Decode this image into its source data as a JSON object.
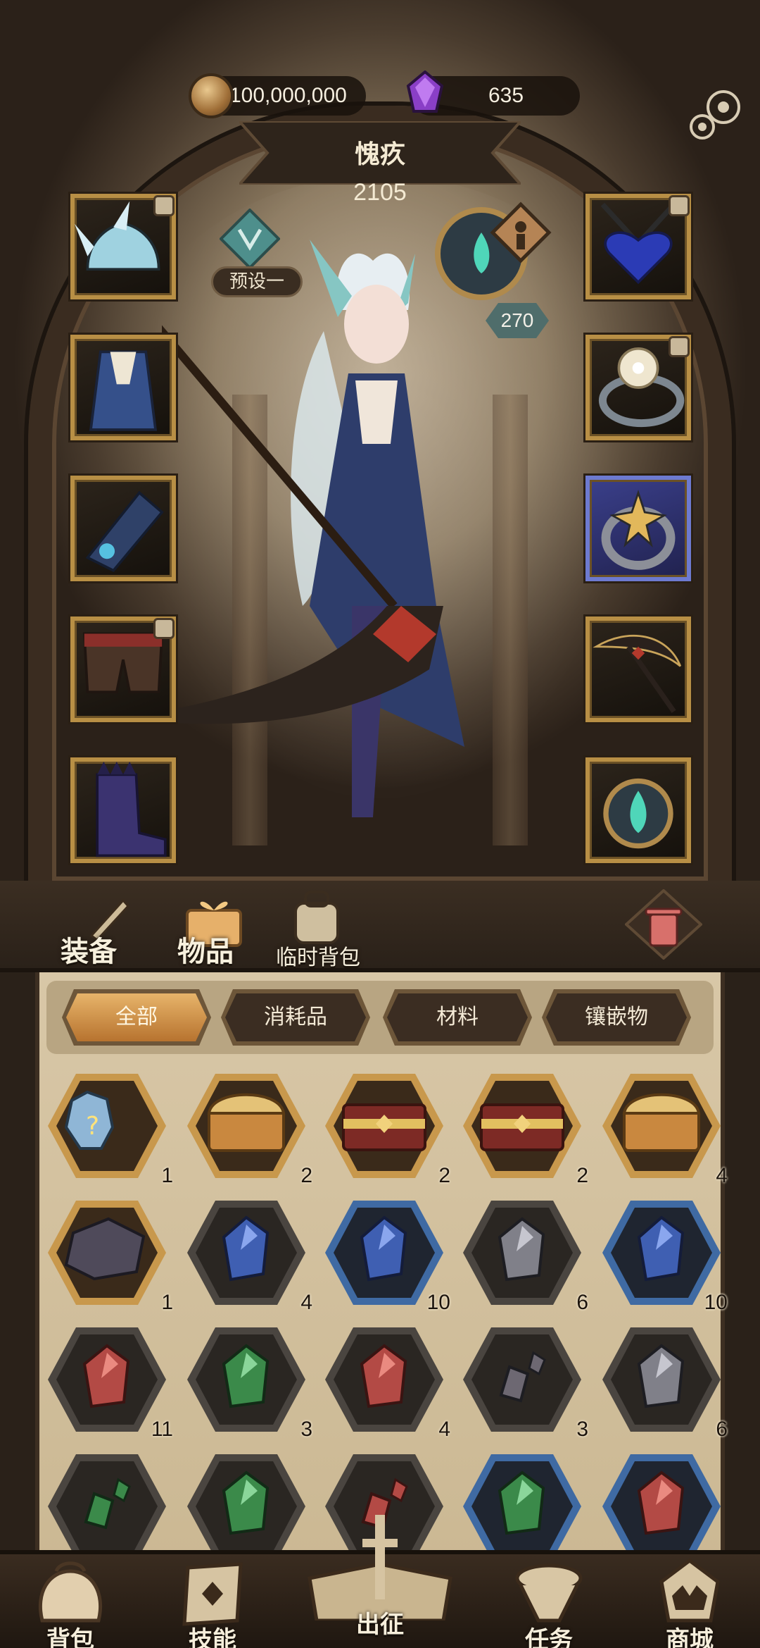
{
  "header": {
    "gold": "100,000,000",
    "gems": "635",
    "character_name": "愧疚",
    "power": "2105",
    "preset_label": "预设一",
    "level": "270"
  },
  "main_tabs": {
    "equipment": "装备",
    "items": "物品",
    "temp_bag": "临时背包"
  },
  "sub_tabs": [
    "全部",
    "消耗品",
    "材料",
    "镶嵌物"
  ],
  "items": [
    {
      "icon": "mystery-crystal-icon",
      "count": "1",
      "frame": "gold"
    },
    {
      "icon": "gold-chest-icon",
      "count": "2",
      "frame": "gold"
    },
    {
      "icon": "red-chest-icon",
      "count": "2",
      "frame": "gold"
    },
    {
      "icon": "red-chest-icon",
      "count": "2",
      "frame": "gold"
    },
    {
      "icon": "gold-chest-icon",
      "count": "4",
      "frame": "gold"
    },
    {
      "icon": "dark-ore-icon",
      "count": "1",
      "frame": "gold"
    },
    {
      "icon": "blue-gem-icon",
      "count": "4",
      "frame": "gray"
    },
    {
      "icon": "blue-gem-icon",
      "count": "10",
      "frame": "blue"
    },
    {
      "icon": "gray-gem-icon",
      "count": "6",
      "frame": "gray"
    },
    {
      "icon": "blue-gem-icon",
      "count": "10",
      "frame": "blue"
    },
    {
      "icon": "red-gem-icon",
      "count": "11",
      "frame": "gray"
    },
    {
      "icon": "green-gem-icon",
      "count": "3",
      "frame": "gray"
    },
    {
      "icon": "red-gem-icon",
      "count": "4",
      "frame": "gray"
    },
    {
      "icon": "gray-shard-icon",
      "count": "3",
      "frame": "gray"
    },
    {
      "icon": "gray-gem-icon",
      "count": "6",
      "frame": "gray"
    },
    {
      "icon": "green-shard-icon",
      "count": "",
      "frame": "gray"
    },
    {
      "icon": "green-gem-icon",
      "count": "",
      "frame": "gray"
    },
    {
      "icon": "red-shard-icon",
      "count": "",
      "frame": "gray"
    },
    {
      "icon": "green-gem-icon",
      "count": "",
      "frame": "blue"
    },
    {
      "icon": "red-gem-icon",
      "count": "",
      "frame": "blue"
    }
  ],
  "nav": {
    "bag": "背包",
    "skills": "技能",
    "expedition": "出征",
    "quests": "任务",
    "shop": "商城"
  },
  "colors": {
    "gold_frame": "#c8984c",
    "blue_frame": "#3f6aa3",
    "gray_frame": "#4a4540",
    "active_tab": "#d89a52"
  }
}
